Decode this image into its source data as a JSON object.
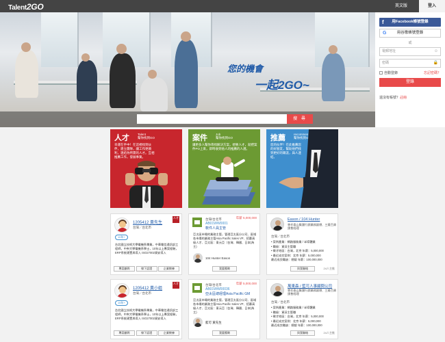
{
  "topbar": {
    "logo_text": "Talent",
    "logo_mark": "2GO",
    "lang_label": "英文版",
    "login_tab": "登入"
  },
  "hero": {
    "tagline_line1": "您的機會",
    "tagline_line2": "一起2GO~"
  },
  "search": {
    "placeholder": "",
    "button_label": "搜 尋"
  },
  "login": {
    "facebook_label": "用Facebook帳號登錄",
    "google_label": "用谷歌帳號登錄",
    "or_label": "或",
    "account_placeholder": "電郵地址",
    "password_placeholder": "密碼",
    "remember_label": "自動登錄",
    "forgot_label": "忘記密碼？",
    "submit_label": "登錄",
    "signup_prefix": "還沒有帳號？",
    "signup_link": "註冊"
  },
  "categories": [
    {
      "title": "人才",
      "sub_en": "Talent",
      "sub_zh": "幫你找到GO",
      "desc": "幸運在手中！在這裡找到伙伴，建立團隊，讓工作更順利，連結你所需的人才。互相推薦工作，發展事業。"
    },
    {
      "title": "案件",
      "sub_en": "Job",
      "sub_zh": "幫你找到GO",
      "desc": "讓更多人幫你尋找解決方案，想要人才，就把案件PO上來，即時收到他人的推薦的人選。"
    },
    {
      "title": "推薦",
      "sub_en": "recommend",
      "sub_zh": "幫你找到GO",
      "desc": "您的伙伴！在此推薦您的好朋友，幫助他們找到更好的職涯，與人連結。"
    }
  ],
  "talent_cards": [
    {
      "name": "1205412  黃先生",
      "loc": "台灣／台北市",
      "chip": "10年+",
      "desc": "台北國立技術大學電機系畢業，中華電信通訊部工程師，中央大學電機系學士，10年以上專案經驗，ERP系統建置與導入 ISO27002資安導入",
      "buttons": [
        "專案顧問",
        "線下認證",
        "企業教練"
      ]
    },
    {
      "name": "1205412  黃小姐",
      "loc": "台灣／台北市",
      "chip": "15年+",
      "desc": "台北國立技術大學電機系畢業，中華電信通訊部工程師，中央大學電機系學士，10年以上專案經驗，ERP系統建置與導入 ISO27002資安導入",
      "buttons": [
        "專案顧問",
        "線下認證",
        "企業教練"
      ]
    }
  ],
  "job_cards": [
    {
      "loc": "台灣/台北市",
      "salary": "年薪 5,000,000",
      "code": "AB01WW0001",
      "title": "軟件人員主管",
      "desc": "亞太區市場的業務主管，管理亞太區分公司、區域各市場的業務主管Asia Pacific Sales VP、招募高級人才、亞太區：東元亞（台灣、韓國、日本(為主)",
      "person": "104 Hunter  Eason",
      "button": "我要應徵"
    },
    {
      "loc": "台灣/台北市",
      "salary": "年薪 5,000,000",
      "code": "AB01WW00036",
      "title": "亞太區總經理Asia Pacific GM",
      "desc": "亞太區市場的業務主管，管理亞太區分公司、區域各市場的業務主管Asia Pacific Sales VP、招募高級人才、亞太區：東元亞（台灣、韓國、日本(為主)",
      "person": "藍可  黃先生",
      "button": "我要應徵"
    }
  ],
  "hunter_cards": [
    {
      "name": "Eason  / 104 Hunter",
      "company": "曾任泰山集團行銷業務副總、三菱百貨銷售經理",
      "loc": "台灣／台北市",
      "items": [
        "• 案例產業：網路服務業 / 半導體業",
        "• 職級：資深主管職",
        "• 徵才地區：台灣，北京 年薪：5,000,000",
        "• 最近成交案例：北京 年薪：5,000,000",
        "最近成交職缺：總裁 年薪：100,000,000"
      ],
      "button": "與我聯絡",
      "count": "24人主推"
    },
    {
      "name": "萬東森 / 藍可人事顧問公司",
      "company": "曾任泰山集團行銷業務副總、三菱百貨銷售經理",
      "loc": "台灣／台北市",
      "items": [
        "• 案例產業：網路服務業 / 半導體業",
        "• 職級：資深主管職",
        "• 徵才地區：台灣，北京 年薪：5,000,000",
        "• 最近成交案例：北京 年薪：5,000,000",
        "最近成交職缺：總裁 年薪：100,000,000"
      ],
      "button": "與我聯絡",
      "count": "24人主推"
    }
  ],
  "colors": {
    "accent_red": "#e84a4a",
    "talent_red": "#c8262d",
    "job_green": "#6c9a33",
    "recommend_blue": "#3f8fce",
    "facebook_blue": "#3b5998"
  }
}
